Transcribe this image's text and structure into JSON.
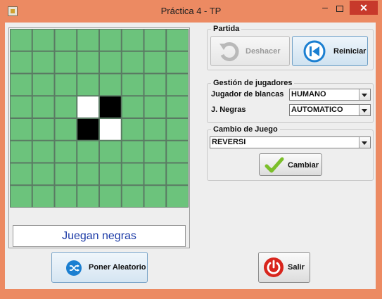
{
  "window": {
    "title": "Práctica 4 - TP"
  },
  "titlebar": {
    "minimize_label": "–",
    "close_label": "✕"
  },
  "board": {
    "rows": 8,
    "cols": 8,
    "pieces": [
      {
        "row": 3,
        "col": 3,
        "color": "white"
      },
      {
        "row": 3,
        "col": 4,
        "color": "black"
      },
      {
        "row": 4,
        "col": 3,
        "color": "black"
      },
      {
        "row": 4,
        "col": 4,
        "color": "white"
      }
    ],
    "cell_color": "#6cc37c",
    "grid_color": "#5a7a63"
  },
  "status": {
    "text": "Juegan negras",
    "color": "#1b3aa6"
  },
  "partida": {
    "legend": "Partida",
    "deshacer_label": "Deshacer",
    "deshacer_icon": "undo-icon",
    "reiniciar_label": "Reiniciar",
    "reiniciar_icon": "skip-back-icon"
  },
  "gestion": {
    "legend": "Gestión de jugadores",
    "blancas_label": "Jugador de blancas",
    "blancas_value": "HUMANO",
    "negras_label": "J. Negras",
    "negras_value": "AUTOMATICO"
  },
  "cambio": {
    "legend": "Cambio de Juego",
    "juego_value": "REVERSI",
    "cambiar_label": "Cambiar",
    "cambiar_icon": "checkmark-icon"
  },
  "bottom": {
    "aleatorio_label": "Poner Aleatorio",
    "aleatorio_icon": "shuffle-icon",
    "salir_label": "Salir",
    "salir_icon": "power-icon"
  },
  "colors": {
    "titlebar_bg": "#ec8a62",
    "close_bg": "#c7392b",
    "accent_blue": "#1b7fd1",
    "power_red": "#d8251d"
  }
}
